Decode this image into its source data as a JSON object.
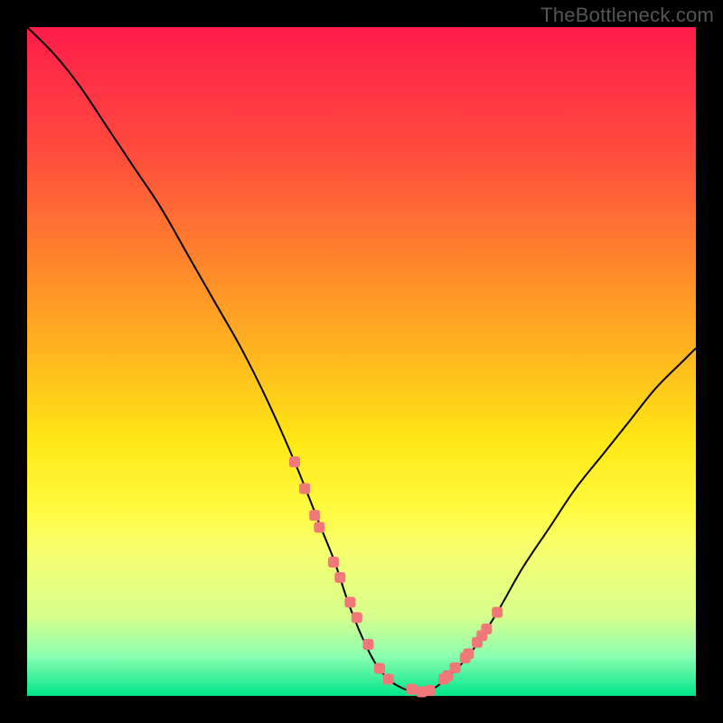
{
  "watermark": "TheBottleneck.com",
  "chart_data": {
    "type": "line",
    "title": "",
    "xlabel": "",
    "ylabel": "",
    "xlim": [
      0,
      100
    ],
    "ylim": [
      0,
      100
    ],
    "grid": false,
    "legend": false,
    "series": [
      {
        "name": "bottleneck-curve",
        "x": [
          0,
          4,
          8,
          12,
          16,
          20,
          24,
          28,
          32,
          36,
          40,
          44,
          46,
          48,
          50,
          52,
          54,
          56,
          58,
          60,
          62,
          66,
          70,
          74,
          78,
          82,
          86,
          90,
          94,
          98,
          100
        ],
        "y": [
          100,
          96,
          91,
          85,
          79,
          73,
          66,
          59,
          52,
          44,
          35,
          25,
          20,
          14,
          9,
          5,
          2.5,
          1.2,
          0.6,
          0.8,
          2,
          6,
          12,
          19,
          25,
          31,
          36,
          41,
          46,
          50,
          52
        ]
      }
    ],
    "markers": {
      "name": "highlighted-points",
      "color": "#f07878",
      "x": [
        40,
        41.5,
        43,
        43.7,
        45.8,
        46.8,
        48.3,
        49.3,
        51,
        52.7,
        54,
        57.5,
        59,
        60.2,
        62.3,
        62.9,
        64,
        65.5,
        66,
        67.3,
        68,
        68.7,
        70.3
      ],
      "y": [
        35,
        31,
        27,
        25.2,
        20,
        17.7,
        14,
        11.7,
        7.7,
        4.1,
        2.5,
        1,
        0.6,
        0.8,
        2.5,
        3,
        4.2,
        5.7,
        6.3,
        8,
        9,
        10,
        12.5
      ]
    },
    "background_gradient": [
      "#ff1c4a",
      "#ff4a3d",
      "#ff7a2f",
      "#ffb31f",
      "#ffe815",
      "#fffb40",
      "#f7ff6e",
      "#d8ff8c",
      "#8cffb0",
      "#00e58a"
    ]
  }
}
